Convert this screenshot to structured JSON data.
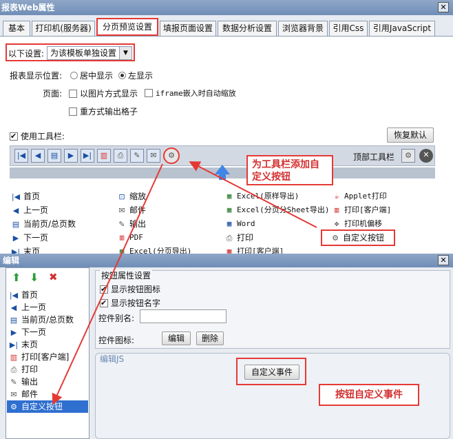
{
  "window": {
    "title": "报表Web属性",
    "close": "✕"
  },
  "tabs": [
    "基本",
    "打印机(服务器)",
    "分页预览设置",
    "填报页面设置",
    "数据分析设置",
    "浏览器背景",
    "引用Css",
    "引用JavaScript"
  ],
  "settings": {
    "scope_label": "以下设置:",
    "scope_value": "为该模板单独设置",
    "position_label": "报表显示位置:",
    "center": "居中显示",
    "left": "左显示",
    "page_label": "页面:",
    "as_image": "以图片方式显示",
    "iframe": "iframe嵌入时自动缩放",
    "repeat": "重方式输出格子",
    "use_toolbar": "使用工具栏:",
    "restore": "恢复默认",
    "top_toolbar": "顶部工具栏"
  },
  "callouts": {
    "add": "为工具栏添加自定义按钮",
    "event": "按钮自定义事件"
  },
  "buttons_grid": {
    "col1": [
      "首页",
      "上一页",
      "当前页/总页数",
      "下一页",
      "末页"
    ],
    "col2": [
      "缩放",
      "邮件",
      "输出",
      "PDF",
      "Excel(分页导出)"
    ],
    "col3": [
      "Excel(原样导出)",
      "Excel(分页分Sheet导出)",
      "Word",
      "打印",
      "打印[客户端]"
    ],
    "col4": [
      "Applet打印",
      "打印[客户端]",
      "打印机偏移",
      "自定义按钮"
    ]
  },
  "edit": {
    "title": "编辑",
    "close": "✕",
    "list": [
      "首页",
      "上一页",
      "当前页/总页数",
      "下一页",
      "末页",
      "打印[客户端]",
      "打印",
      "输出",
      "邮件",
      "自定义按钮"
    ],
    "props_title": "按钮属性设置",
    "show_icon": "显示按钮图标",
    "show_name": "显示按钮名字",
    "alias_label": "控件别名:",
    "alias_value": "",
    "icon_label": "控件图标:",
    "edit_btn": "编辑",
    "delete_btn": "删除",
    "js_title": "编辑JS",
    "custom_event": "自定义事件"
  }
}
